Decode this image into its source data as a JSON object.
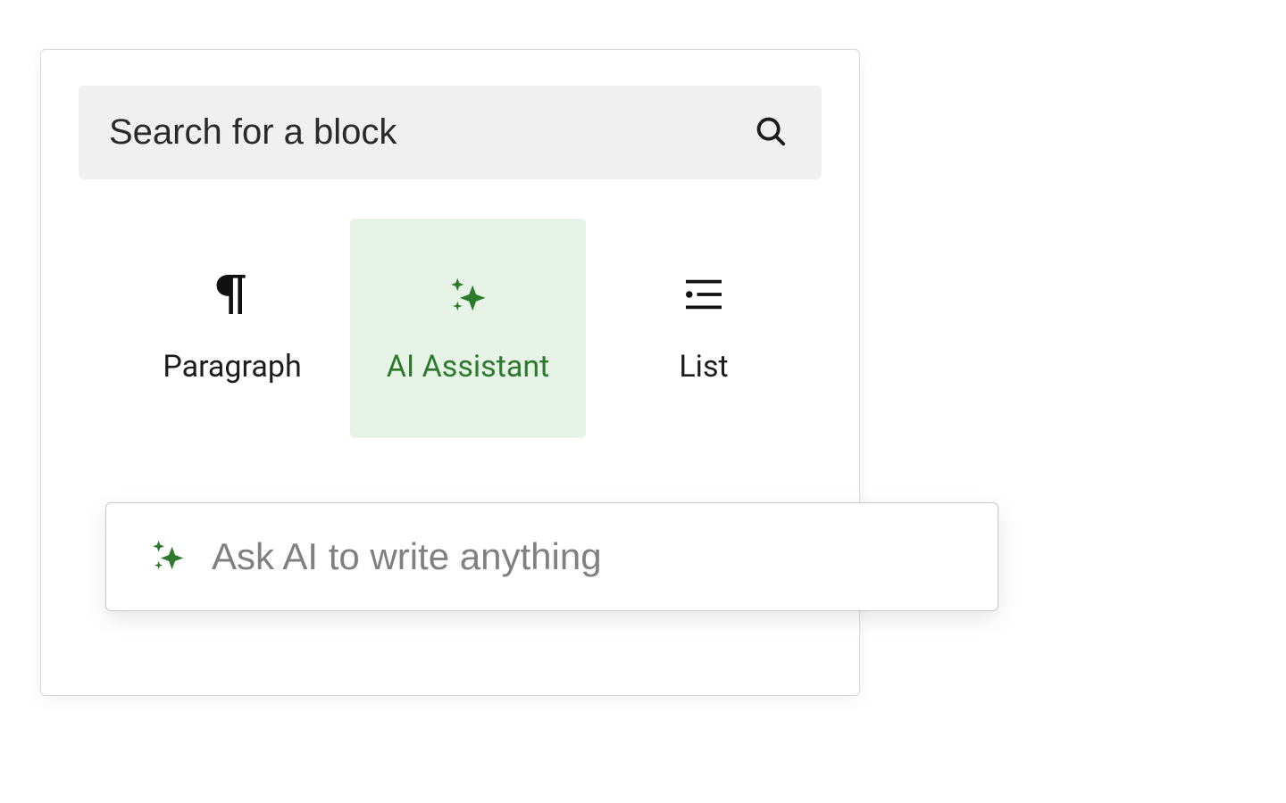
{
  "search": {
    "placeholder": "Search for a block"
  },
  "blocks": [
    {
      "id": "paragraph",
      "label": "Paragraph",
      "icon": "pilcrow",
      "selected": false
    },
    {
      "id": "ai-assistant",
      "label": "AI Assistant",
      "icon": "sparkles",
      "selected": true
    },
    {
      "id": "list",
      "label": "List",
      "icon": "list",
      "selected": false
    }
  ],
  "ai_prompt": {
    "placeholder": "Ask AI to write anything"
  },
  "colors": {
    "accent_green": "#2c7a2c",
    "selected_bg": "#e7f3e7",
    "search_bg": "#f0f0f0",
    "border": "#d9d9d9",
    "prompt_border": "#c7c7c7"
  }
}
